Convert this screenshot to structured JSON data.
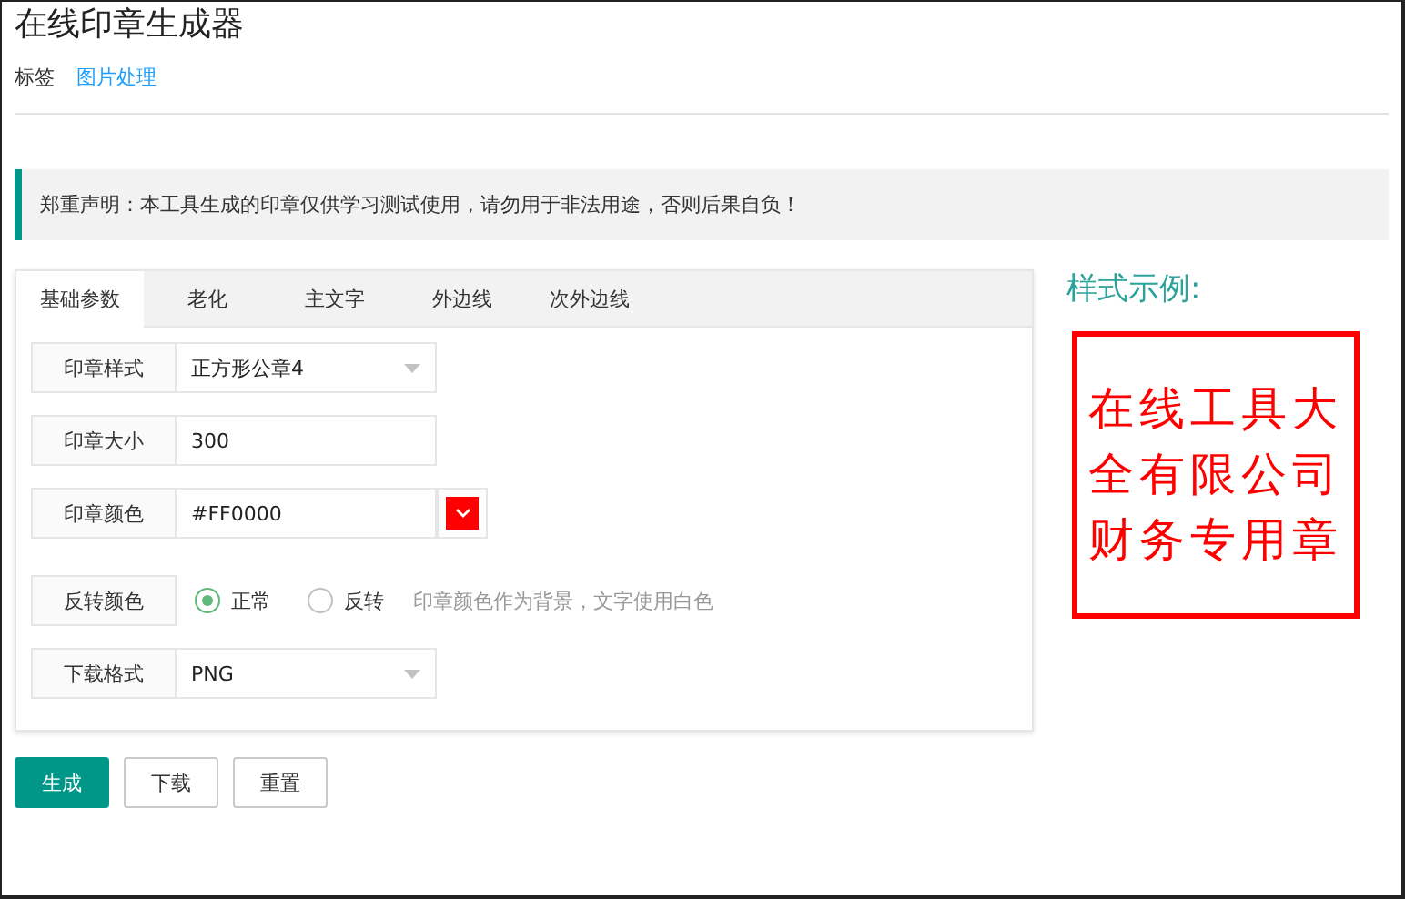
{
  "title": "在线印章生成器",
  "tags": {
    "label": "标签",
    "links": [
      "图片处理"
    ]
  },
  "notice": "郑重声明：本工具生成的印章仅供学习测试使用，请勿用于非法用途，否则后果自负！",
  "tabs": [
    {
      "label": "基础参数",
      "selected": true
    },
    {
      "label": "老化",
      "selected": false
    },
    {
      "label": "主文字",
      "selected": false
    },
    {
      "label": "外边线",
      "selected": false
    },
    {
      "label": "次外边线",
      "selected": false
    }
  ],
  "fields": [
    {
      "kind": "select",
      "label": "印章样式",
      "value": "正方形公章4"
    },
    {
      "kind": "input",
      "label": "印章大小",
      "value": "300"
    },
    {
      "kind": "color",
      "label": "印章颜色",
      "value": "#FF0000",
      "color": "#ff0000"
    },
    {
      "kind": "radio",
      "label": "反转颜色",
      "options": [
        {
          "label": "正常",
          "selected": true
        },
        {
          "label": "反转",
          "selected": false
        }
      ],
      "hint": "印章颜色作为背景，文字使用白色"
    },
    {
      "kind": "select",
      "label": "下载格式",
      "value": "PNG"
    }
  ],
  "buttons": [
    {
      "label": "生成",
      "primary": true
    },
    {
      "label": "下载",
      "primary": false
    },
    {
      "label": "重置",
      "primary": false
    }
  ],
  "preview": {
    "title": "样式示例:",
    "stamp_lines": [
      "在线工具大",
      "全有限公司",
      "财务专用章"
    ]
  }
}
